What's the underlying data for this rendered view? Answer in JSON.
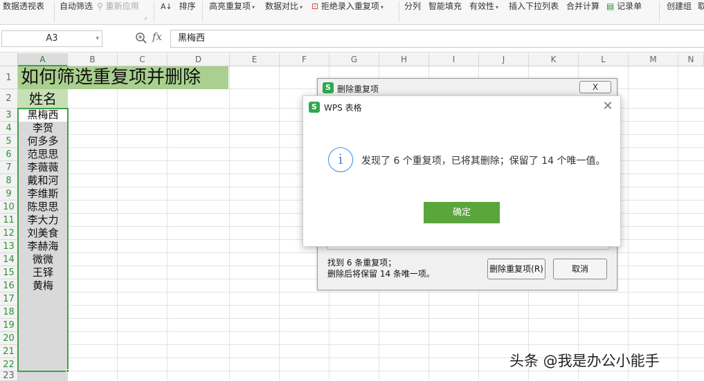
{
  "ribbon": {
    "items": [
      {
        "label": "数据透视表"
      },
      {
        "label": "自动筛选"
      },
      {
        "label": "重新应用"
      },
      {
        "label": "排序"
      },
      {
        "label": "高亮重复项"
      },
      {
        "label": "数据对比"
      },
      {
        "label": "拒绝录入重复项"
      },
      {
        "label": "分列"
      },
      {
        "label": "智能填充"
      },
      {
        "label": "有效性"
      },
      {
        "label": "插入下拉列表"
      },
      {
        "label": "合并计算"
      },
      {
        "label": "记录单"
      },
      {
        "label": "创建组"
      },
      {
        "label": "取"
      }
    ]
  },
  "formula_bar": {
    "name_box": "A3",
    "fx": "fx",
    "value": "黑梅西"
  },
  "grid": {
    "columns": [
      "A",
      "B",
      "C",
      "D",
      "E",
      "F",
      "G",
      "H",
      "I",
      "J",
      "K",
      "L",
      "M",
      "N"
    ],
    "rows": [
      "1",
      "2",
      "3",
      "4",
      "5",
      "6",
      "7",
      "8",
      "9",
      "10",
      "11",
      "12",
      "13",
      "14",
      "15",
      "16",
      "17",
      "18",
      "19",
      "20",
      "21",
      "22",
      "23"
    ],
    "title": "如何筛选重复项并删除",
    "header": "姓名",
    "names": [
      "黑梅西",
      "李贺",
      "何多多",
      "范思思",
      "李薇薇",
      "戴和河",
      "李维斯",
      "陈思思",
      "李大力",
      "刘美食",
      "李赫海",
      "微微",
      "王铎",
      "黄梅"
    ]
  },
  "bg_dialog": {
    "title": "删除重复项",
    "close_label": "X",
    "info_line1": "找到 6 条重复项；",
    "info_line2": "删除后将保留 14 条唯一项。",
    "delete_button": "删除重复项(R)",
    "cancel_button": "取消"
  },
  "alert_dialog": {
    "title": "WPS 表格",
    "message": "发现了 6 个重复项，已将其删除；保留了 14 个唯一值。",
    "ok_button": "确定",
    "icon": "info-icon"
  },
  "watermark": "头条 @我是办公小能手",
  "colors": {
    "title_fill": "#a9d08e",
    "header_fill": "#c6e0b4",
    "selection": "#3fa04a",
    "ok_button": "#5aa63c"
  }
}
